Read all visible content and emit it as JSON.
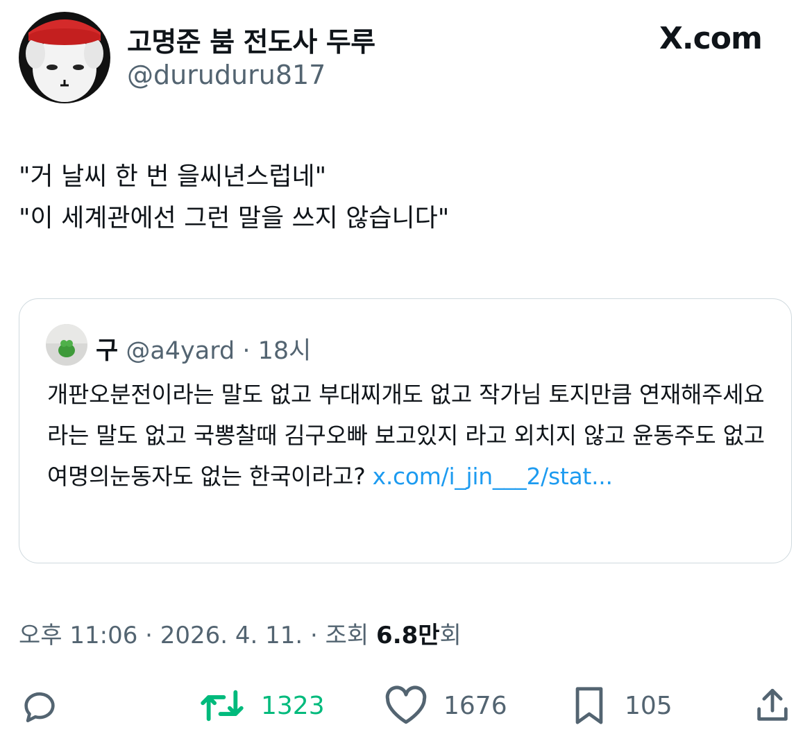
{
  "author": {
    "name": "고명준 붐 전도사 두루",
    "handle": "@duruduru817"
  },
  "brand": "X.com",
  "tweet": {
    "lines": [
      "\"거 날씨 한 번 을씨년스럽네\"",
      "\"이 세계관에선 그런 말을 쓰지 않습니다\""
    ]
  },
  "quote": {
    "name": "구",
    "handle": "@a4yard",
    "time": "· 18시",
    "text": "개판오분전이라는 말도 없고 부대찌개도 없고 작가님 토지만큼 연재해주세요 라는 말도 없고 국뽕찰때 김구오빠 보고있지 라고 외치지 않고 윤동주도 없고 여명의눈동자도 없는 한국이라고? ",
    "link": "x.com/i_jin___2/stat..."
  },
  "meta": {
    "time": "오후 11:06 · 2026. 4. 11. · 조회 ",
    "views": "6.8만",
    "views_suffix": "회"
  },
  "actions": {
    "retweets": "1323",
    "likes": "1676",
    "bookmarks": "105"
  },
  "colors": {
    "text": "#0f1419",
    "secondary": "#536471",
    "link": "#1d9bf0",
    "retweet": "#00ba7c",
    "border": "#cfd9de"
  },
  "icons": [
    "reply-icon",
    "retweet-icon",
    "heart-icon",
    "bookmark-icon",
    "share-icon"
  ]
}
